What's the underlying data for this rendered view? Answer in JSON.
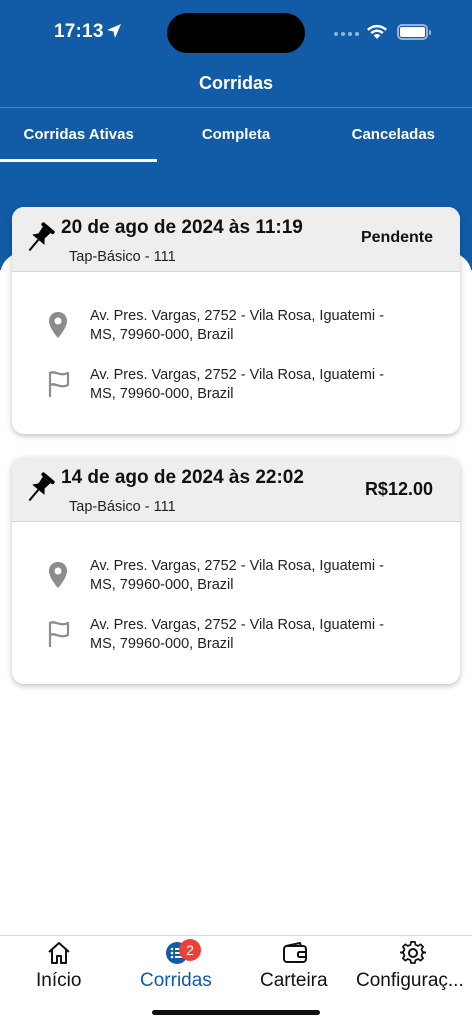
{
  "status_bar": {
    "time": "17:13"
  },
  "header": {
    "title": "Corridas"
  },
  "tabs": [
    {
      "label": "Corridas Ativas",
      "active": true
    },
    {
      "label": "Completa",
      "active": false
    },
    {
      "label": "Canceladas",
      "active": false
    }
  ],
  "rides": [
    {
      "date": "20 de ago de 2024 às 11:19",
      "service": "Tap-Básico - 111",
      "status": "Pendente",
      "origin_line1": "Av. Pres. Vargas, 2752 - Vila Rosa, Iguatemi -",
      "origin_line2": "MS, 79960-000, Brazil",
      "destination_line1": "Av. Pres. Vargas, 2752 - Vila Rosa, Iguatemi -",
      "destination_line2": "MS, 79960-000, Brazil"
    },
    {
      "date": "14 de ago de 2024 às 22:02",
      "service": "Tap-Básico - 111",
      "price": "R$12.00",
      "origin_line1": "Av. Pres. Vargas, 2752 - Vila Rosa, Iguatemi -",
      "origin_line2": "MS, 79960-000, Brazil",
      "destination_line1": "Av. Pres. Vargas, 2752 - Vila Rosa, Iguatemi -",
      "destination_line2": "MS, 79960-000, Brazil"
    }
  ],
  "bottom_nav": {
    "items": [
      {
        "label": "Início",
        "icon": "home-icon",
        "active": false
      },
      {
        "label": "Corridas",
        "icon": "list-icon",
        "active": true,
        "badge": "2"
      },
      {
        "label": "Carteira",
        "icon": "wallet-icon",
        "active": false
      },
      {
        "label": "Configuraç...",
        "icon": "gear-icon",
        "active": false
      }
    ]
  },
  "colors": {
    "primary": "#115ba7",
    "badge": "#ef3f39"
  }
}
